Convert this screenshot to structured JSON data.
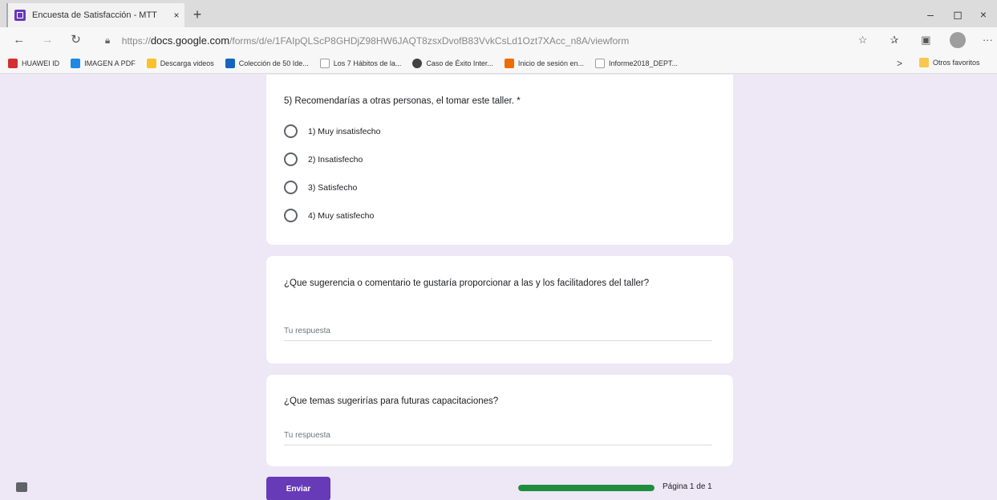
{
  "browser": {
    "tab_title": "Encuesta de Satisfacción - MTT",
    "tab_close": "×",
    "new_tab": "+",
    "window_controls": {
      "minimize": "–",
      "maximize": "◻",
      "close": "×"
    },
    "url_prefix": "https://",
    "url_domain": "docs.google.com",
    "url_path": "/forms/d/e/1FAIpQLScP8GHDjZ98HW6JAQT8zsxDvofB83VvkCsLd1Ozt7XAcc_n8A/viewform",
    "favorites": [
      {
        "label": "HUAWEI ID",
        "color": "#d32f2f"
      },
      {
        "label": "IMAGEN A PDF",
        "color": "#1e88e5"
      },
      {
        "label": "Descarga videos",
        "color": "#fbc02d"
      },
      {
        "label": "Colección de 50 Ide...",
        "color": "#1565c0"
      },
      {
        "label": "Los 7 Hábitos de la...",
        "color": "#9e9e9e"
      },
      {
        "label": "Caso de Éxito Inter...",
        "color": "#424242"
      },
      {
        "label": "Inicio de sesión en...",
        "color": "#ef6c00"
      },
      {
        "label": "Informe2018_DEPT...",
        "color": "#9e9e9e"
      }
    ],
    "fav_chevron": ">",
    "other_favorites": "Otros favoritos"
  },
  "form": {
    "question5": {
      "text": "5) Recomendarías a otras personas, el tomar este taller. *",
      "options": [
        "1) Muy insatisfecho",
        "2) Insatisfecho",
        "3) Satisfecho",
        "4) Muy satisfecho"
      ]
    },
    "question_suggest": {
      "text": "¿Que sugerencia o comentario te gustaría proporcionar a las y los facilitadores del taller?",
      "placeholder": "Tu respuesta"
    },
    "question_topics": {
      "text": "¿Que temas sugerirías para futuras capacitaciones?",
      "placeholder": "Tu respuesta"
    },
    "submit_label": "Enviar",
    "page_indicator": "Página 1 de 1",
    "progress": 1.0
  }
}
